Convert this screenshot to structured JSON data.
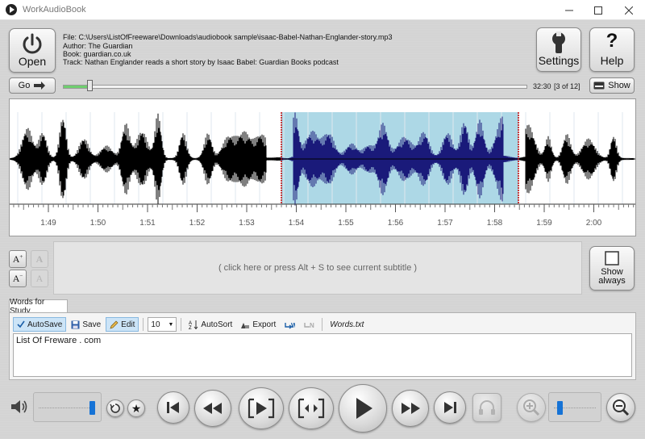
{
  "window": {
    "title": "WorkAudioBook"
  },
  "toolbar": {
    "open_label": "Open",
    "settings_label": "Settings",
    "help_label": "Help",
    "go_label": "Go",
    "show_label": "Show"
  },
  "info": {
    "file": "File:  C:\\Users\\ListOfFreeware\\Downloads\\audiobook sample\\isaac-Babel-Nathan-Englander-story.mp3",
    "author": "Author:  The Guardian",
    "book": "Book:  guardian.co.uk",
    "track": "Track:  Nathan Englander reads a short story by Isaac Babel: Guardian Books podcast"
  },
  "progress": {
    "total_time": "32:30",
    "track_counter": "[3 of 12]",
    "position_fraction": 0.06
  },
  "waveform": {
    "time_labels": [
      "1:49",
      "1:50",
      "1:51",
      "1:52",
      "1:53",
      "1:54",
      "1:55",
      "1:56",
      "1:57",
      "1:58",
      "1:59",
      "2:00"
    ],
    "selection_color": "#add8e6",
    "selected_wave_color": "#1a1a7a",
    "wave_color": "#000000"
  },
  "subtitle": {
    "placeholder": "( click here or press Alt + S to see current subtitle )",
    "show_always_line1": "Show",
    "show_always_line2": "always"
  },
  "words": {
    "tab_label": "Words for Study",
    "autosave_label": "AutoSave",
    "save_label": "Save",
    "edit_label": "Edit",
    "font_size": "10",
    "autosort_label": "AutoSort",
    "export_label": "Export",
    "filename": "Words.txt",
    "content": "List Of Freware . com"
  },
  "playback": {
    "volume_level": 0.9,
    "zoom_level": 0.08
  },
  "colors": {
    "accent": "#1673d6",
    "progress_fill": "#6fcf6f"
  }
}
